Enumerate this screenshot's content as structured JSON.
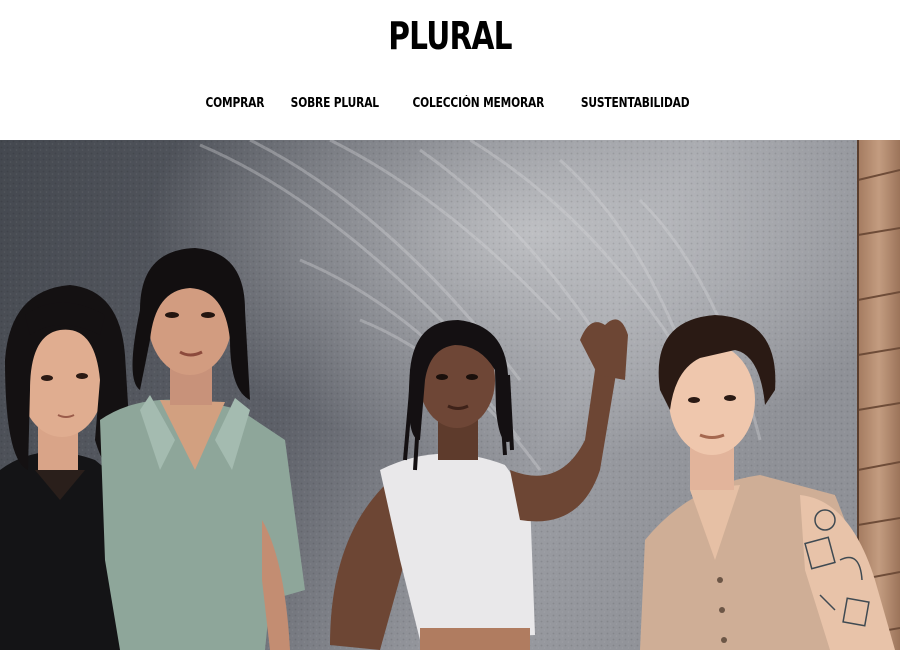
{
  "brand": {
    "logo_text": "PLURAL"
  },
  "nav": {
    "items": [
      {
        "label": "COMPRAR"
      },
      {
        "label": "SOBRE PLURAL"
      },
      {
        "label": "COLECCIÓN MEMORAR"
      },
      {
        "label": "SUSTENTABILIDAD"
      }
    ]
  },
  "hero": {
    "colors": {
      "wall_shadow": "#4a4e56",
      "wall_light": "#a8aab0",
      "wood": "#b98f73"
    }
  }
}
